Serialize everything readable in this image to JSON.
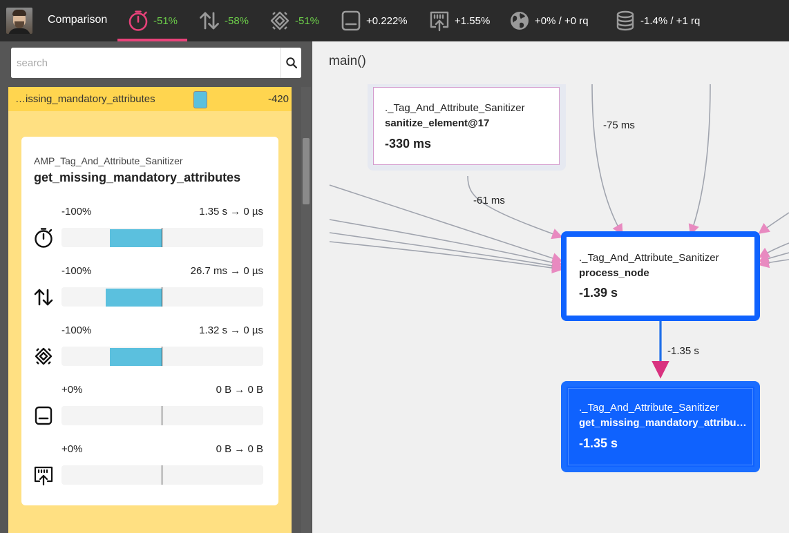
{
  "header": {
    "title": "Comparison",
    "metrics": [
      {
        "icon": "stopwatch-icon",
        "value": "-51%",
        "color": "#6dd04a"
      },
      {
        "icon": "io-arrows-icon",
        "value": "-58%",
        "color": "#6dd04a"
      },
      {
        "icon": "cpu-chip-icon",
        "value": "-51%",
        "color": "#6dd04a"
      },
      {
        "icon": "memory-icon",
        "value": "+0.222%",
        "color": "#ffffff"
      },
      {
        "icon": "network-icon",
        "value": "+1.55%",
        "color": "#ffffff"
      },
      {
        "icon": "globe-icon",
        "value": "+0% / +0 rq",
        "color": "#ffffff"
      },
      {
        "icon": "database-icon",
        "value": "-1.4% / +1 rq",
        "color": "#ffffff"
      }
    ],
    "active_accent": "#e8427a"
  },
  "sidebar": {
    "search_placeholder": "search",
    "list": {
      "name": "…issing_mandatory_attributes",
      "value": "-420"
    },
    "detail": {
      "class": "AMP_Tag_And_Attribute_Sanitizer",
      "function": "get_missing_mandatory_attributes",
      "stats": [
        {
          "icon": "stopwatch-icon",
          "percent": "-100%",
          "change": "1.35 s → 0 µs",
          "fill": -0.52
        },
        {
          "icon": "io-arrows-icon",
          "percent": "-100%",
          "change": "26.7 ms → 0 µs",
          "fill": -0.56
        },
        {
          "icon": "cpu-chip-icon",
          "percent": "-100%",
          "change": "1.32 s → 0 µs",
          "fill": -0.52
        },
        {
          "icon": "memory-icon",
          "percent": "+0%",
          "change": "0 B → 0 B",
          "fill": 0
        },
        {
          "icon": "network-icon",
          "percent": "+0%",
          "change": "0 B → 0 B",
          "fill": 0
        }
      ]
    }
  },
  "graph": {
    "title": "main()",
    "nodes": {
      "sanitize": {
        "class": "._Tag_And_Attribute_Sanitizer",
        "function": "sanitize_element@17",
        "time": "-330 ms"
      },
      "process": {
        "class": "._Tag_And_Attribute_Sanitizer",
        "function": "process_node",
        "time": "-1.39 s"
      },
      "missing": {
        "class": "._Tag_And_Attribute_Sanitizer",
        "function": "get_missing_mandatory_attributes",
        "time": "-1.35 s"
      }
    },
    "edge_labels": {
      "top_right": "-75 ms",
      "sanitize_to_process": "-61 ms",
      "process_to_missing": "-1.35 s"
    },
    "colors": {
      "node_border": "#0f62fe",
      "edge": "#a0a4ae",
      "arrow": "#e88ac0",
      "main_edge": "#1f6fe8",
      "main_arrow": "#d9327f",
      "bar": "#5bc0de"
    }
  }
}
